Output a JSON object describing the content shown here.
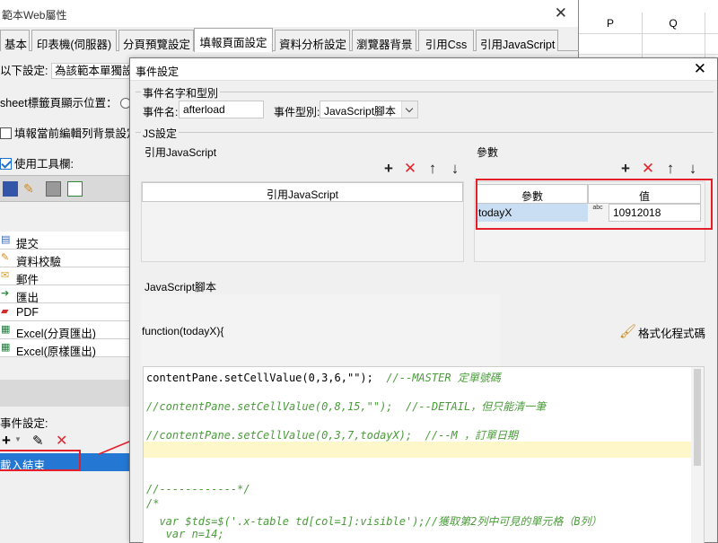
{
  "sheet": {
    "columns": [
      "P",
      "Q"
    ]
  },
  "bg_dialog": {
    "title": "範本Web屬性",
    "tabs": [
      "基本",
      "印表機(伺服器)",
      "分頁預覽設定",
      "填報頁面設定",
      "資料分析設定",
      "瀏覽器背景",
      "引用Css",
      "引用JavaScript"
    ],
    "active_tab": "填報頁面設定",
    "setting_label": "以下設定:",
    "setting_value": "為該範本單獨設定",
    "sheet_tab_label": "sheet標籤頁顯示位置：",
    "fill_bg_label": "填報當前編輯列背景設定",
    "toolbar_label": "使用工具欄:",
    "buttons": [
      "提交",
      "資料校驗",
      "郵件",
      "匯出",
      "PDF",
      "Excel(分頁匯出)",
      "Excel(原樣匯出)"
    ],
    "event_label": "事件設定:",
    "event_item": "載入結束"
  },
  "dialog": {
    "title": "事件設定",
    "group_name": "事件名字和型別",
    "event_name_label": "事件名:",
    "event_name_value": "afterload",
    "event_type_label": "事件型別:",
    "event_type_value": "JavaScript腳本",
    "js_group": "JS設定",
    "ref_js_caption": "引用JavaScript",
    "ref_js_header": "引用JavaScript",
    "params_caption": "參數",
    "param_col1": "參數",
    "param_col2": "值",
    "param_name": "todayX",
    "param_value": "10912018",
    "param_type_icon": "abc",
    "script_caption": "JavaScript腳本",
    "function_sig": "function(todayX){",
    "format_label": "格式化程式碼",
    "code_lines": [
      {
        "code": "contentPane.setCellValue(0,3,6,\"\");  ",
        "comment": "//--MASTER 定單號碼"
      },
      {
        "code": "",
        "comment": "//contentPane.setCellValue(0,8,15,\"\");  //--DETAIL，但只能清一筆"
      },
      {
        "code": "",
        "comment": "//contentPane.setCellValue(0,3,7,todayX);  //--M ，訂單日期"
      },
      {
        "code": "",
        "comment": ""
      },
      {
        "code": "",
        "comment": ""
      },
      {
        "code": "",
        "comment": "//------------*/"
      },
      {
        "code": "",
        "comment": "/*"
      },
      {
        "code": "",
        "comment": "  var $tds=$('.x-table td[col=1]:visible');//獲取第2列中可見的單元格（B列）"
      },
      {
        "code": "",
        "comment": "   var n=14;"
      }
    ]
  }
}
